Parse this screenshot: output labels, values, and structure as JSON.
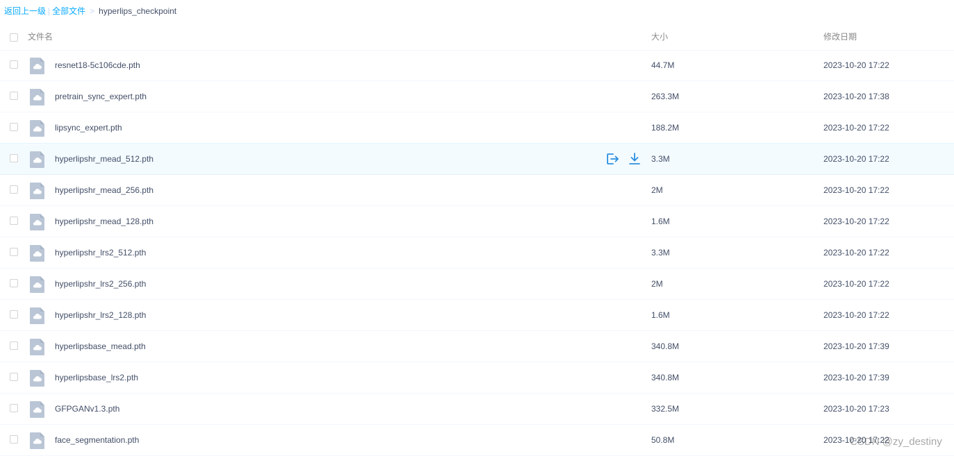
{
  "breadcrumb": {
    "back": "返回上一级",
    "separator": "|",
    "all_files": "全部文件",
    "arrow": ">",
    "current": "hyperlips_checkpoint"
  },
  "header": {
    "name": "文件名",
    "size": "大小",
    "date": "修改日期"
  },
  "files": [
    {
      "name": "resnet18-5c106cde.pth",
      "size": "44.7M",
      "date": "2023-10-20 17:22"
    },
    {
      "name": "pretrain_sync_expert.pth",
      "size": "263.3M",
      "date": "2023-10-20 17:38"
    },
    {
      "name": "lipsync_expert.pth",
      "size": "188.2M",
      "date": "2023-10-20 17:22"
    },
    {
      "name": "hyperlipshr_mead_512.pth",
      "size": "3.3M",
      "date": "2023-10-20 17:22"
    },
    {
      "name": "hyperlipshr_mead_256.pth",
      "size": "2M",
      "date": "2023-10-20 17:22"
    },
    {
      "name": "hyperlipshr_mead_128.pth",
      "size": "1.6M",
      "date": "2023-10-20 17:22"
    },
    {
      "name": "hyperlipshr_lrs2_512.pth",
      "size": "3.3M",
      "date": "2023-10-20 17:22"
    },
    {
      "name": "hyperlipshr_lrs2_256.pth",
      "size": "2M",
      "date": "2023-10-20 17:22"
    },
    {
      "name": "hyperlipshr_lrs2_128.pth",
      "size": "1.6M",
      "date": "2023-10-20 17:22"
    },
    {
      "name": "hyperlipsbase_mead.pth",
      "size": "340.8M",
      "date": "2023-10-20 17:39"
    },
    {
      "name": "hyperlipsbase_lrs2.pth",
      "size": "340.8M",
      "date": "2023-10-20 17:39"
    },
    {
      "name": "GFPGANv1.3.pth",
      "size": "332.5M",
      "date": "2023-10-20 17:23"
    },
    {
      "name": "face_segmentation.pth",
      "size": "50.8M",
      "date": "2023-10-20 17:22"
    }
  ],
  "hovered_row": 3,
  "row_actions": [
    "share-icon",
    "download-icon"
  ],
  "watermark": "CSDN @zy_destiny",
  "colors": {
    "link": "#09aaff",
    "hover_bg": "#f4fbff",
    "icon_blue": "#2b8fe0",
    "file_icon": "#bac6d6"
  }
}
